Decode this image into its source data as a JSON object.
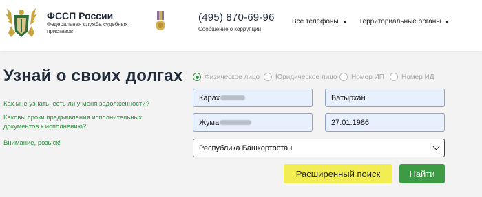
{
  "header": {
    "title": "ФССП России",
    "subtitle": "Федеральная служба судебных приставов",
    "phone": "(495) 870-69-96",
    "phone_caption": "Сообщение о коррупции",
    "nav": [
      {
        "label": "Все телефоны",
        "icon": "caret-down-icon"
      },
      {
        "label": "Территориальные органы",
        "icon": "caret-down-icon"
      }
    ]
  },
  "main": {
    "title": "Узнай о своих долгах",
    "links": [
      "Как мне узнать, есть ли у меня задолженности?",
      "Каковы сроки предъявления исполнительных документов к исполнению?",
      "Внимание, розыск!"
    ]
  },
  "search": {
    "types": [
      {
        "label": "Физическое лицо",
        "selected": true
      },
      {
        "label": "Юридическое лицо",
        "selected": false
      },
      {
        "label": "Номер ИП",
        "selected": false
      },
      {
        "label": "Номер ИД",
        "selected": false
      }
    ],
    "last_name_visible": "Карах",
    "first_name": "Батырхан",
    "middle_name_visible": "Жума",
    "birth_date": "27.01.1986",
    "region": "Республика Башкортостан",
    "advanced_label": "Расширенный поиск",
    "submit_label": "Найти"
  },
  "colors": {
    "accent_green": "#3d9b45",
    "link_green": "#2e8f3e",
    "button_yellow": "#f2ed53",
    "input_fill": "#e8f0fe"
  }
}
